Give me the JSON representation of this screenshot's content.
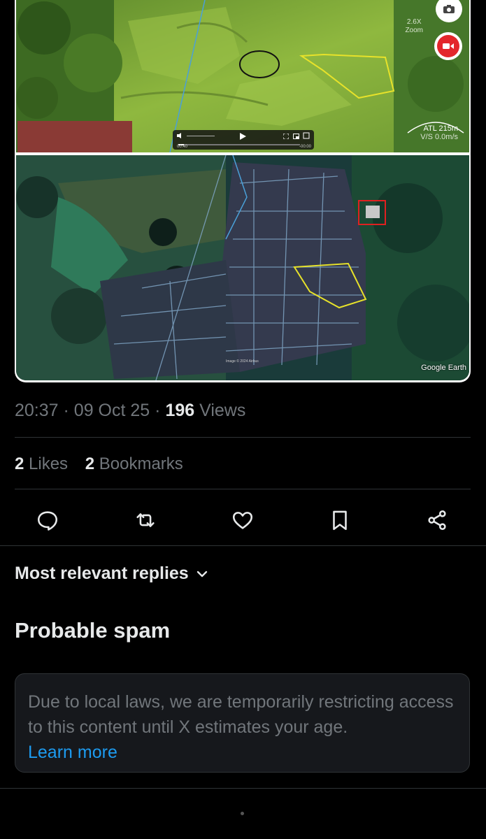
{
  "media": {
    "top_image": {
      "zoom": "2.6X",
      "zoom_word": "Zoom",
      "altitude": "ATL 215m",
      "speed": "V/S 0.0m/s",
      "player": {
        "elapsed": "00:40",
        "remaining": "-00:00"
      }
    },
    "bottom_image": {
      "watermark": "Google Earth",
      "caption_center": "Image © 2024 Airbus"
    }
  },
  "tweet": {
    "time": "20:37",
    "date": "09 Oct 25",
    "views_count": "196",
    "views_label": "Views",
    "likes_count": "2",
    "likes_label": "Likes",
    "bookmarks_count": "2",
    "bookmarks_label": "Bookmarks"
  },
  "actions": [
    "reply-icon",
    "retweet-icon",
    "like-icon",
    "bookmark-icon",
    "share-icon"
  ],
  "replies": {
    "sort_label": "Most relevant replies",
    "spam_heading": "Probable spam",
    "notice_text": "Due to local laws, we are temporarily restricting access to this content until X estimates your age.",
    "notice_link": "Learn more"
  },
  "colors": {
    "background": "#000000",
    "text_primary": "#e7e9ea",
    "text_secondary": "#71767b",
    "link": "#1d9bf0",
    "record": "#e3262b"
  }
}
